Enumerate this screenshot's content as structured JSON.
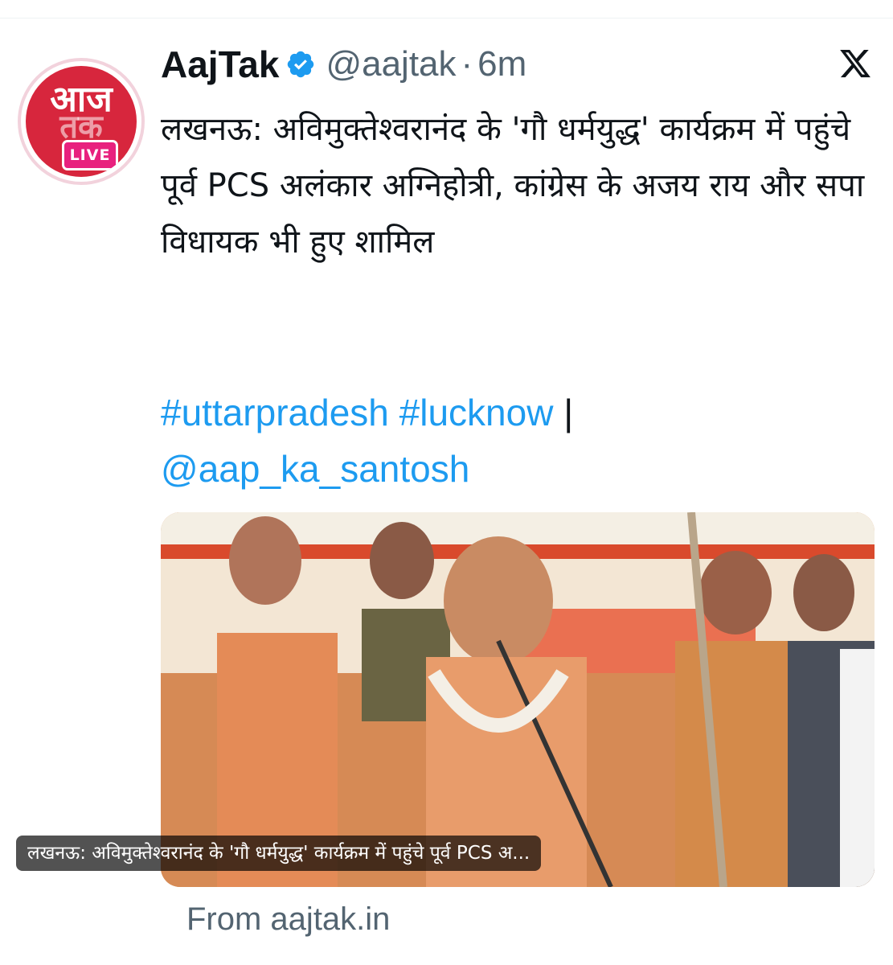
{
  "author": {
    "display_name": "AajTak",
    "handle": "@aajtak",
    "separator": "·",
    "time": "6m",
    "avatar_live_label": "LIVE",
    "avatar_logo_text": "आज",
    "avatar_logo_text2": "तक"
  },
  "tweet": {
    "text": "लखनऊ: अविमुक्तेश्वरानंद के 'गौ धर्मयुद्ध' कार्यक्रम में पहुंचे पूर्व PCS अलंकार अग्निहोत्री, कांग्रेस के अजय राय और सपा विधायक भी हुए शामिल",
    "hashtag1": "#uttarpradesh",
    "hashtag2": "#lucknow",
    "pipe": "|",
    "mention": "@aap_ka_santosh"
  },
  "card": {
    "caption": "लखनऊ: अविमुक्तेश्वरानंद के 'गौ धर्मयुद्ध' कार्यक्रम में पहुंचे पूर्व PCS अ...",
    "source": "From aajtak.in"
  },
  "icons": {
    "verified": "verified-badge-icon",
    "x_logo": "x-logo-icon"
  },
  "colors": {
    "link": "#1d9bf0",
    "brand_red": "#d7263d",
    "live_pink": "#e8217e",
    "muted": "#536471"
  }
}
